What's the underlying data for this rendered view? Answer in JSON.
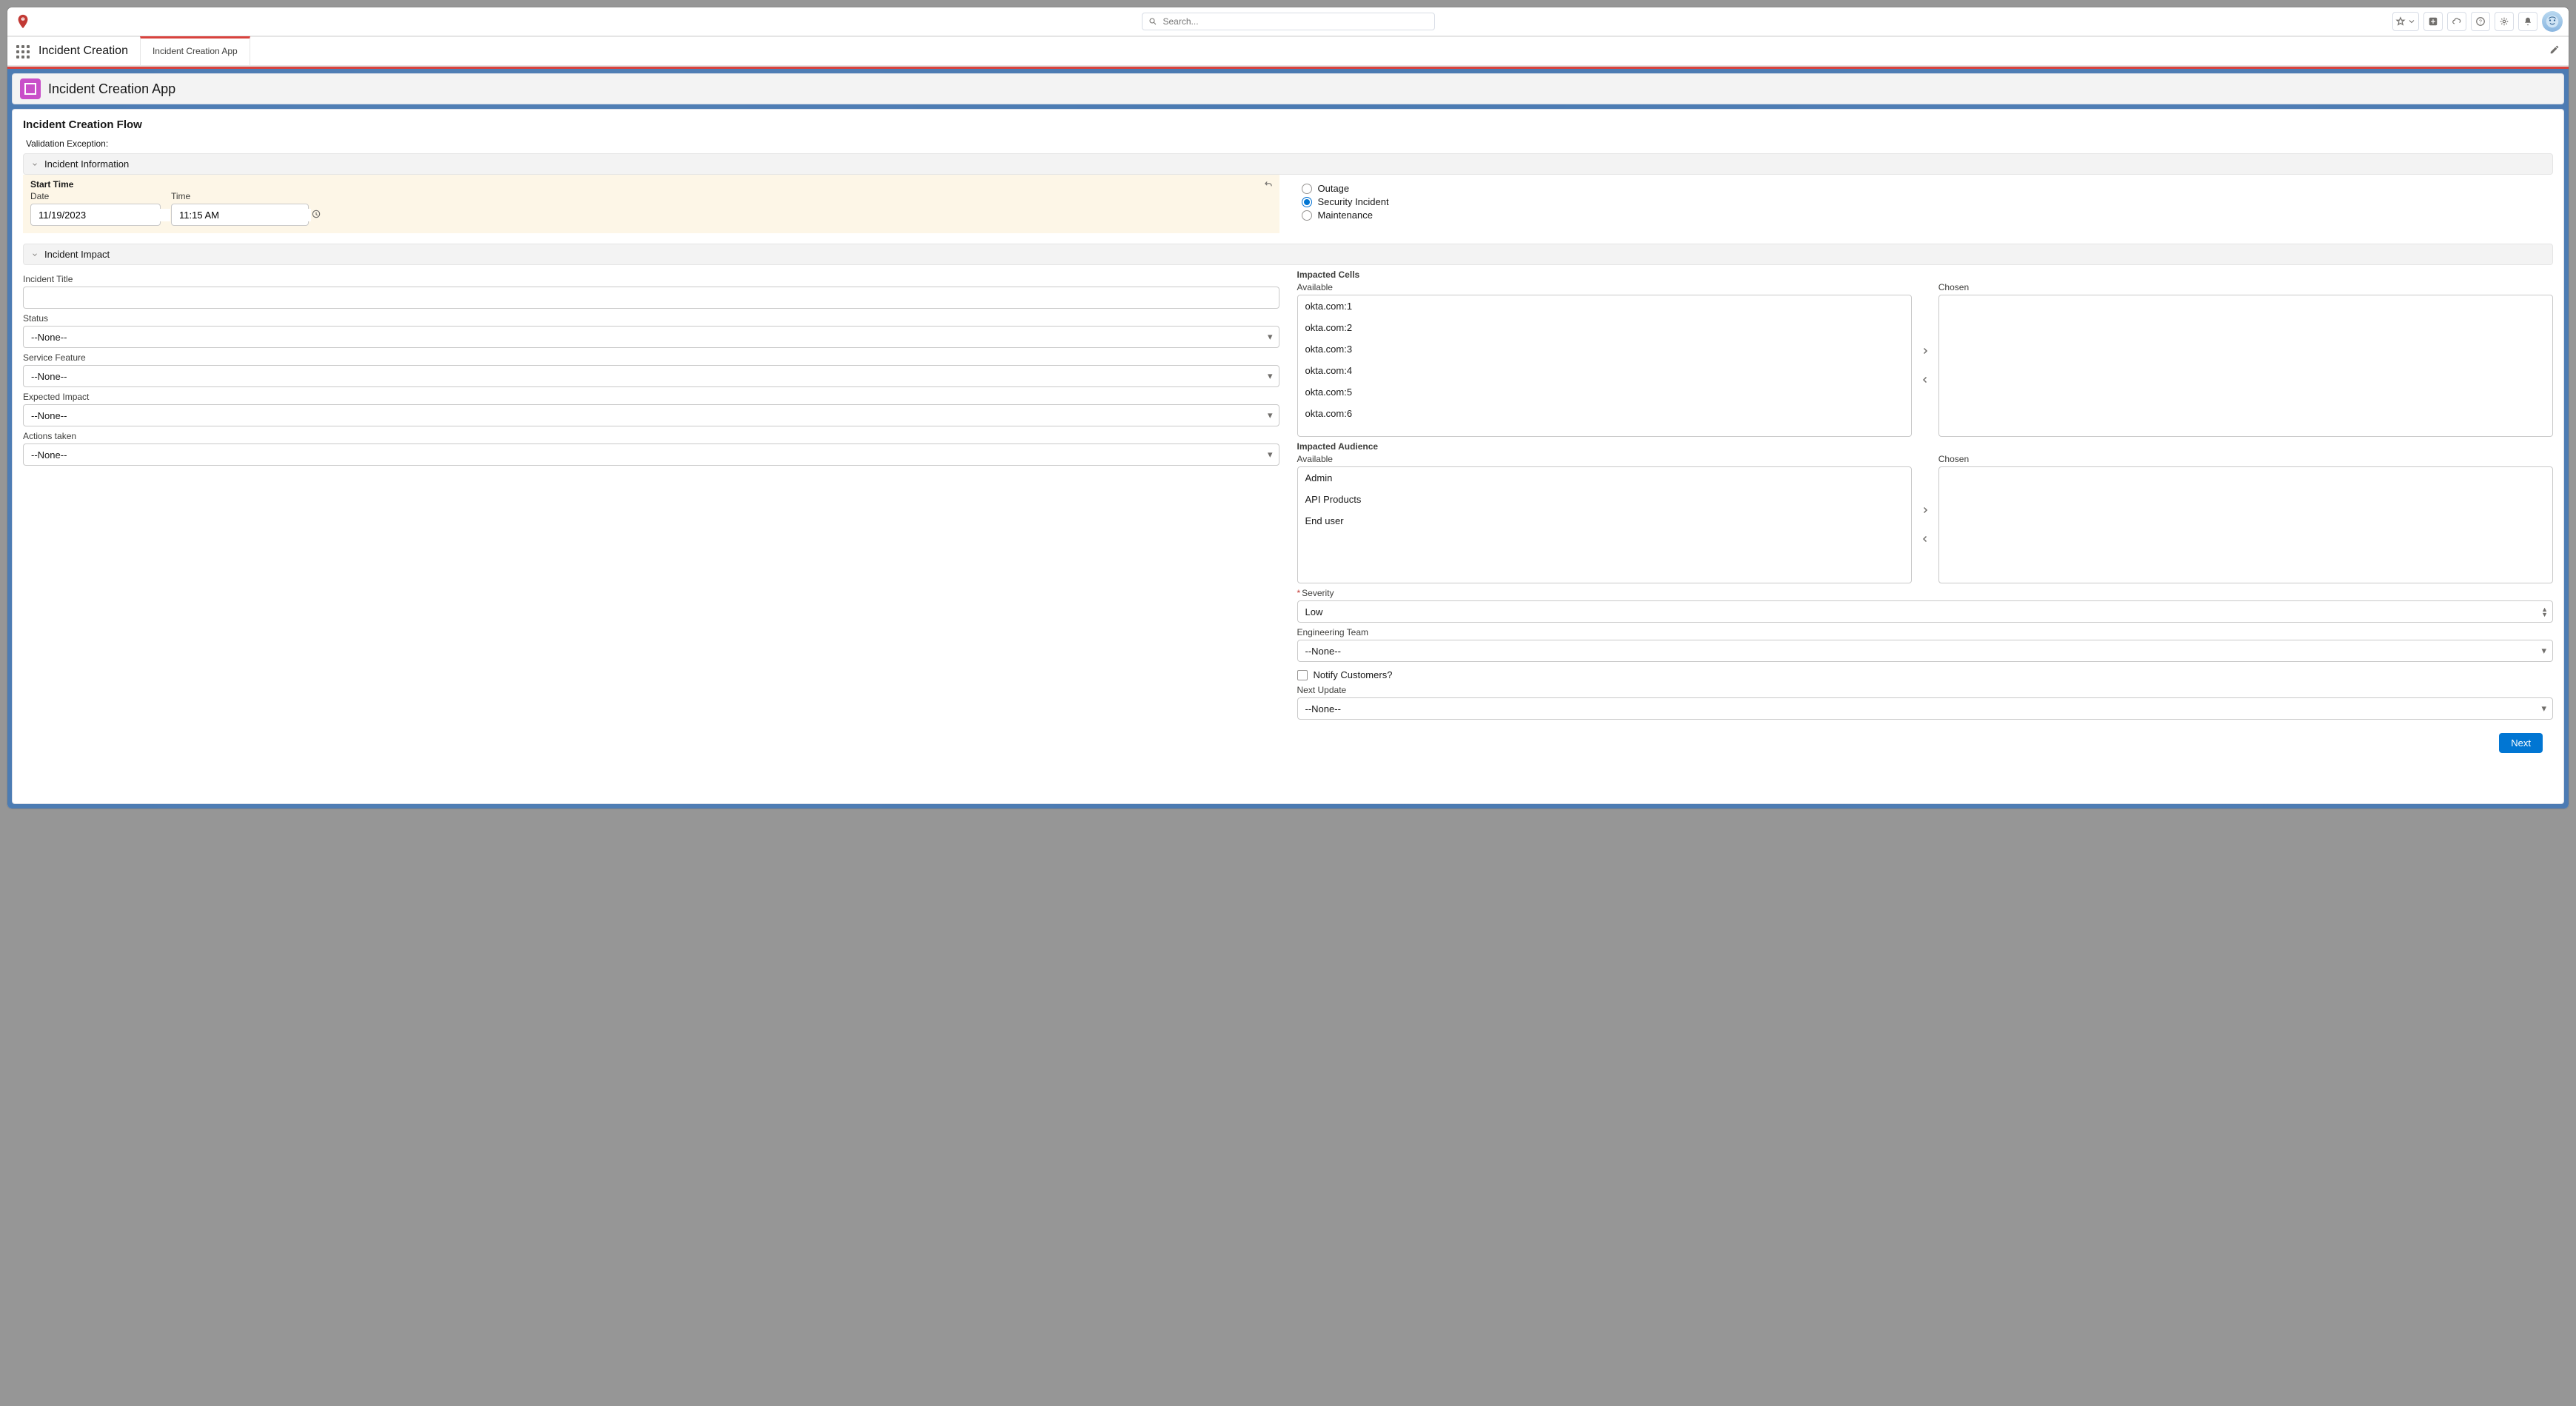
{
  "globalHeader": {
    "searchPlaceholder": "Search..."
  },
  "appNav": {
    "appTitle": "Incident Creation",
    "tabLabel": "Incident Creation App"
  },
  "pageHeader": {
    "title": "Incident Creation App"
  },
  "flow": {
    "title": "Incident Creation Flow",
    "validationLabel": "Validation Exception:"
  },
  "sections": {
    "info": "Incident Information",
    "impact": "Incident Impact"
  },
  "startTime": {
    "groupLabel": "Start Time",
    "dateLabel": "Date",
    "dateValue": "11/19/2023",
    "timeLabel": "Time",
    "timeValue": "11:15 AM"
  },
  "incidentType": {
    "options": {
      "outage": "Outage",
      "security": "Security Incident",
      "maintenance": "Maintenance"
    },
    "selected": "security"
  },
  "leftFields": {
    "incidentTitle": {
      "label": "Incident Title",
      "value": ""
    },
    "status": {
      "label": "Status",
      "value": "--None--"
    },
    "serviceFeature": {
      "label": "Service Feature",
      "value": "--None--"
    },
    "expectedImpact": {
      "label": "Expected Impact",
      "value": "--None--"
    },
    "actionsTaken": {
      "label": "Actions taken",
      "value": "--None--"
    }
  },
  "impactedCells": {
    "groupLabel": "Impacted Cells",
    "availableLabel": "Available",
    "chosenLabel": "Chosen",
    "available": [
      "okta.com:1",
      "okta.com:2",
      "okta.com:3",
      "okta.com:4",
      "okta.com:5",
      "okta.com:6"
    ],
    "chosen": []
  },
  "impactedAudience": {
    "groupLabel": "Impacted Audience",
    "availableLabel": "Available",
    "chosenLabel": "Chosen",
    "available": [
      "Admin",
      "API Products",
      "End user"
    ],
    "chosen": []
  },
  "severity": {
    "label": "Severity",
    "value": "Low",
    "required": true
  },
  "engineeringTeam": {
    "label": "Engineering Team",
    "value": "--None--"
  },
  "notifyCustomers": {
    "label": "Notify Customers?",
    "checked": false
  },
  "nextUpdate": {
    "label": "Next Update",
    "value": "--None--"
  },
  "footer": {
    "nextLabel": "Next"
  }
}
